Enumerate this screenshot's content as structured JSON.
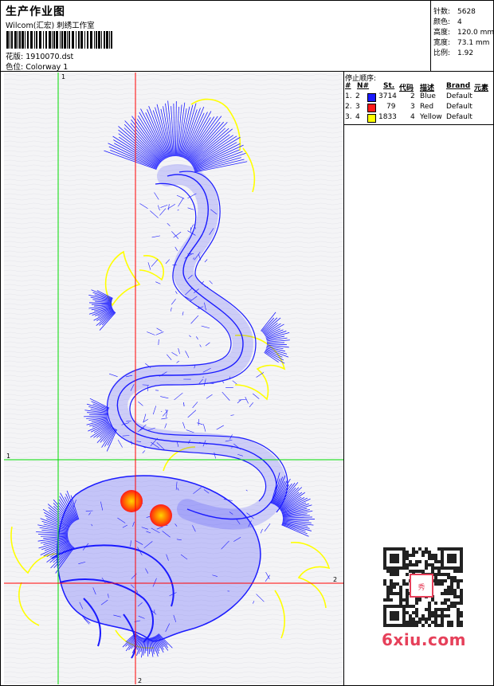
{
  "header": {
    "title": "生产作业图",
    "company": "Wilcom(汇宏) 刺绣工作室",
    "design_file_label": "花版:",
    "design_file": "1910070.dst",
    "colorway_label": "色位:",
    "colorway": "Colorway 1"
  },
  "stats": [
    {
      "label": "针数:",
      "value": "5628"
    },
    {
      "label": "颜色:",
      "value": "4"
    },
    {
      "label": "高度:",
      "value": "120.0 mm"
    },
    {
      "label": "宽度:",
      "value": "73.1 mm"
    },
    {
      "label": "比例:",
      "value": "1.92"
    }
  ],
  "stop_sequence": {
    "header": "停止顺序:",
    "columns": [
      "#",
      "N#",
      "St.",
      "代码",
      "描述",
      "Brand",
      "元素"
    ],
    "rows": [
      {
        "num": "1.",
        "n": "2",
        "color": "#1a1aff",
        "st": "3714",
        "code": "2",
        "desc": "Blue",
        "brand": "Default"
      },
      {
        "num": "2.",
        "n": "3",
        "color": "#ff1a1a",
        "st": "79",
        "code": "3",
        "desc": "Red",
        "brand": "Default"
      },
      {
        "num": "3.",
        "n": "4",
        "color": "#ffff00",
        "st": "1833",
        "code": "4",
        "desc": "Yellow",
        "brand": "Default"
      }
    ]
  },
  "guides": {
    "green_top": "1",
    "green_left": "1",
    "red_bottom": "2",
    "red_right": "2"
  },
  "colors": {
    "thread_blue": "#1a1aff",
    "thread_red": "#ff1a1a",
    "thread_yellow": "#ffff00",
    "guide_green": "#00dd00",
    "guide_red": "#ff0000"
  },
  "watermark": {
    "text": "6xiu.com"
  }
}
